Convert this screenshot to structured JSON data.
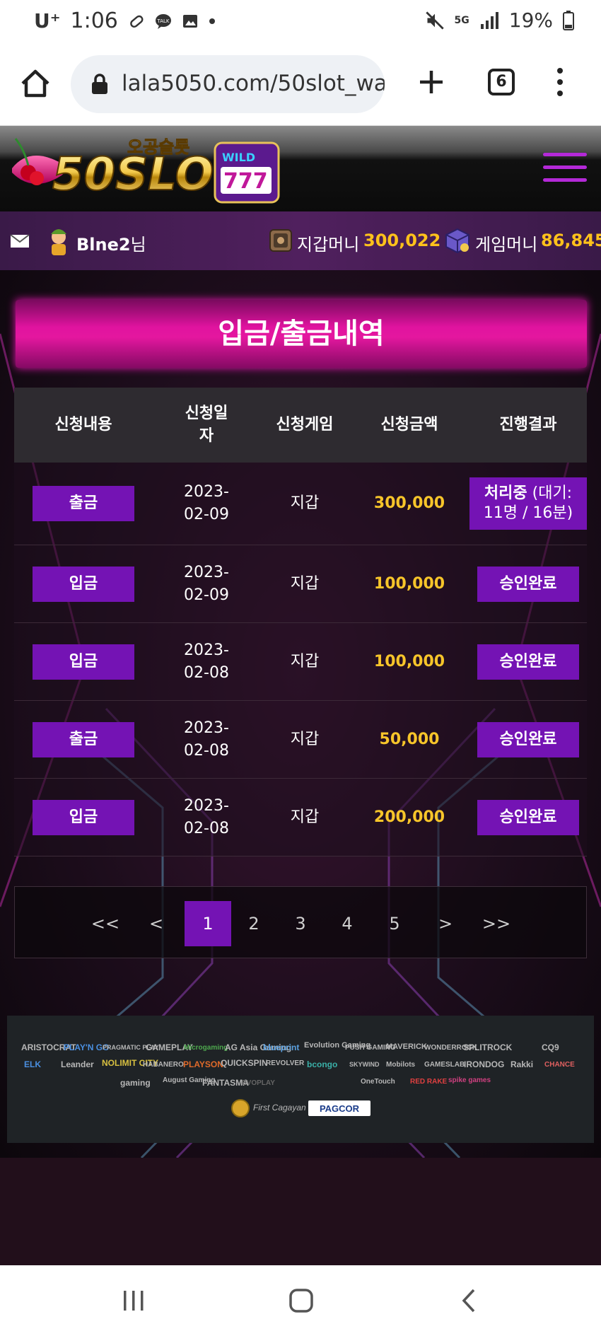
{
  "status_bar": {
    "carrier": "U⁺",
    "time": "1:06",
    "network": "5G",
    "battery": "19%"
  },
  "browser": {
    "url": "lala5050.com/50slot_wa",
    "tab_count": "6"
  },
  "site": {
    "logo_text": "50SLOT",
    "logo_sub": "오공슬롯",
    "logo_badge": "WILD"
  },
  "user": {
    "name": "Blne2",
    "suffix": "님",
    "wallet_label": "지갑머니",
    "wallet_value": "300,022",
    "game_label": "게임머니",
    "game_value": "86,845"
  },
  "page": {
    "title": "입금/출금내역"
  },
  "table": {
    "headers": [
      "신청내용",
      "신청일자",
      "신청게임",
      "신청금액",
      "진행결과"
    ],
    "rows": [
      {
        "type": "출금",
        "date": "2023-02-09",
        "game": "지갑",
        "amount": "300,000",
        "status_bold": "처리중",
        "status": " (대기: 11명 / 16분)"
      },
      {
        "type": "입금",
        "date": "2023-02-09",
        "game": "지갑",
        "amount": "100,000",
        "status_bold": "",
        "status": "승인완료"
      },
      {
        "type": "입금",
        "date": "2023-02-08",
        "game": "지갑",
        "amount": "100,000",
        "status_bold": "",
        "status": "승인완료"
      },
      {
        "type": "출금",
        "date": "2023-02-08",
        "game": "지갑",
        "amount": "50,000",
        "status_bold": "",
        "status": "승인완료"
      },
      {
        "type": "입금",
        "date": "2023-02-08",
        "game": "지갑",
        "amount": "200,000",
        "status_bold": "",
        "status": "승인완료"
      }
    ]
  },
  "pagination": {
    "first": "<<",
    "prev": "<",
    "pages": [
      "1",
      "2",
      "3",
      "4",
      "5"
    ],
    "current": "1",
    "next": ">",
    "last": ">>"
  },
  "footer": {
    "providers": [
      "ARISTOCRAT",
      "PLAY'N GO",
      "PRAGMATIC PLAY",
      "GAMEPLAY",
      "Microgaming",
      "AG Asia Gaming",
      "blueprint",
      "Evolution Gaming",
      "PUSH GAMING",
      "MAVERICK",
      "WONDERROCK",
      "SPLITROCK",
      "",
      "CQ9",
      "ELK",
      "Leander",
      "NOLIMIT CITY",
      "HABANERO",
      "PLAYSON",
      "QUICKSPIN",
      "REVOLVER",
      "bcongo",
      "SKYWIND",
      "Mobilots",
      "GAMESLAB",
      "IRONDOG",
      "Rakki",
      "CHANCE",
      "gaming",
      "August Gaming",
      "FANTASMA",
      "EVOPLAY",
      "",
      "",
      "OneTouch",
      "RED RAKE",
      "spike games"
    ],
    "cert_1": "First Cagayan",
    "cert_2": "PAGCOR"
  },
  "colors": {
    "accent_purple": "#7413b4",
    "title_magenta": "#e0139f",
    "amount_gold": "#f7c52a",
    "hamburger": "#b429d8"
  }
}
